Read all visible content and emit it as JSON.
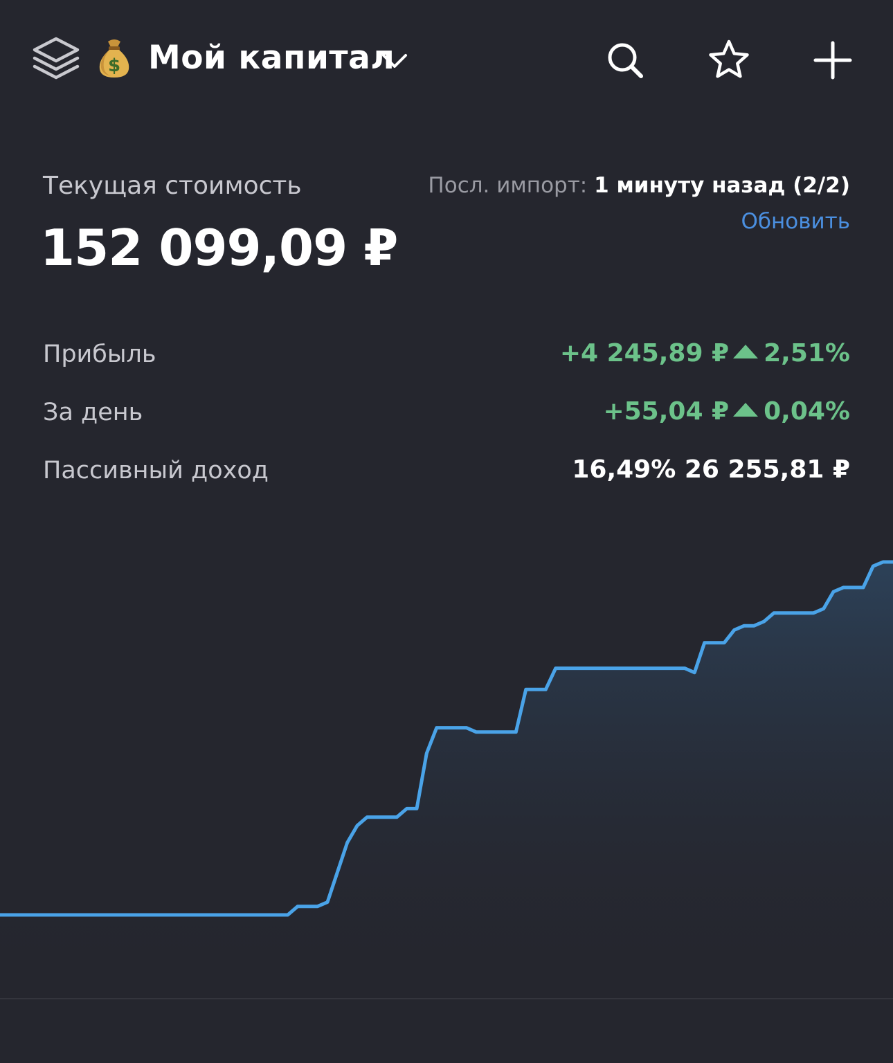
{
  "header": {
    "title": "Мой капитал",
    "icons": [
      "layers-icon",
      "money-bag-icon",
      "chevron-down-icon",
      "search-icon",
      "star-icon",
      "plus-icon"
    ]
  },
  "summary": {
    "value_label": "Текущая стоимость",
    "value_amount": "152 099,09 ₽",
    "import_label": "Посл. импорт: ",
    "import_time": "1 минуту назад (2/2)",
    "refresh": "Обновить"
  },
  "stats": {
    "profit": {
      "label": "Прибыль",
      "amount": "+4 245,89 ₽",
      "percent": "2,51%"
    },
    "day": {
      "label": "За день",
      "amount": "+55,04 ₽",
      "percent": "0,04%"
    },
    "passive": {
      "label": "Пассивный доход",
      "percent": "16,49%",
      "amount": "26 255,81 ₽"
    }
  },
  "colors": {
    "background": "#25262e",
    "positive": "#6cc28a",
    "accent": "#4b8fe0",
    "chart_line": "#4aa3e8"
  },
  "chart_data": {
    "type": "area",
    "series": [
      {
        "values": [
          0,
          0,
          0,
          0,
          0,
          0,
          0,
          0,
          0,
          0,
          0,
          0,
          0,
          0,
          0,
          0,
          0,
          0,
          0,
          0,
          0,
          0,
          0,
          0,
          0,
          0,
          0,
          0,
          0,
          0,
          2,
          2,
          2,
          3,
          10,
          17,
          21,
          23,
          23,
          23,
          23,
          25,
          25,
          38,
          44,
          44,
          44,
          44,
          43,
          43,
          43,
          43,
          43,
          53,
          53,
          53,
          58,
          58,
          58,
          58,
          58,
          58,
          58,
          58,
          58,
          58,
          58,
          58,
          58,
          58,
          57,
          64,
          64,
          64,
          67,
          68,
          68,
          69,
          71,
          71,
          71,
          71,
          71,
          72,
          76,
          77,
          77,
          77,
          82,
          83,
          83
        ]
      }
    ]
  }
}
